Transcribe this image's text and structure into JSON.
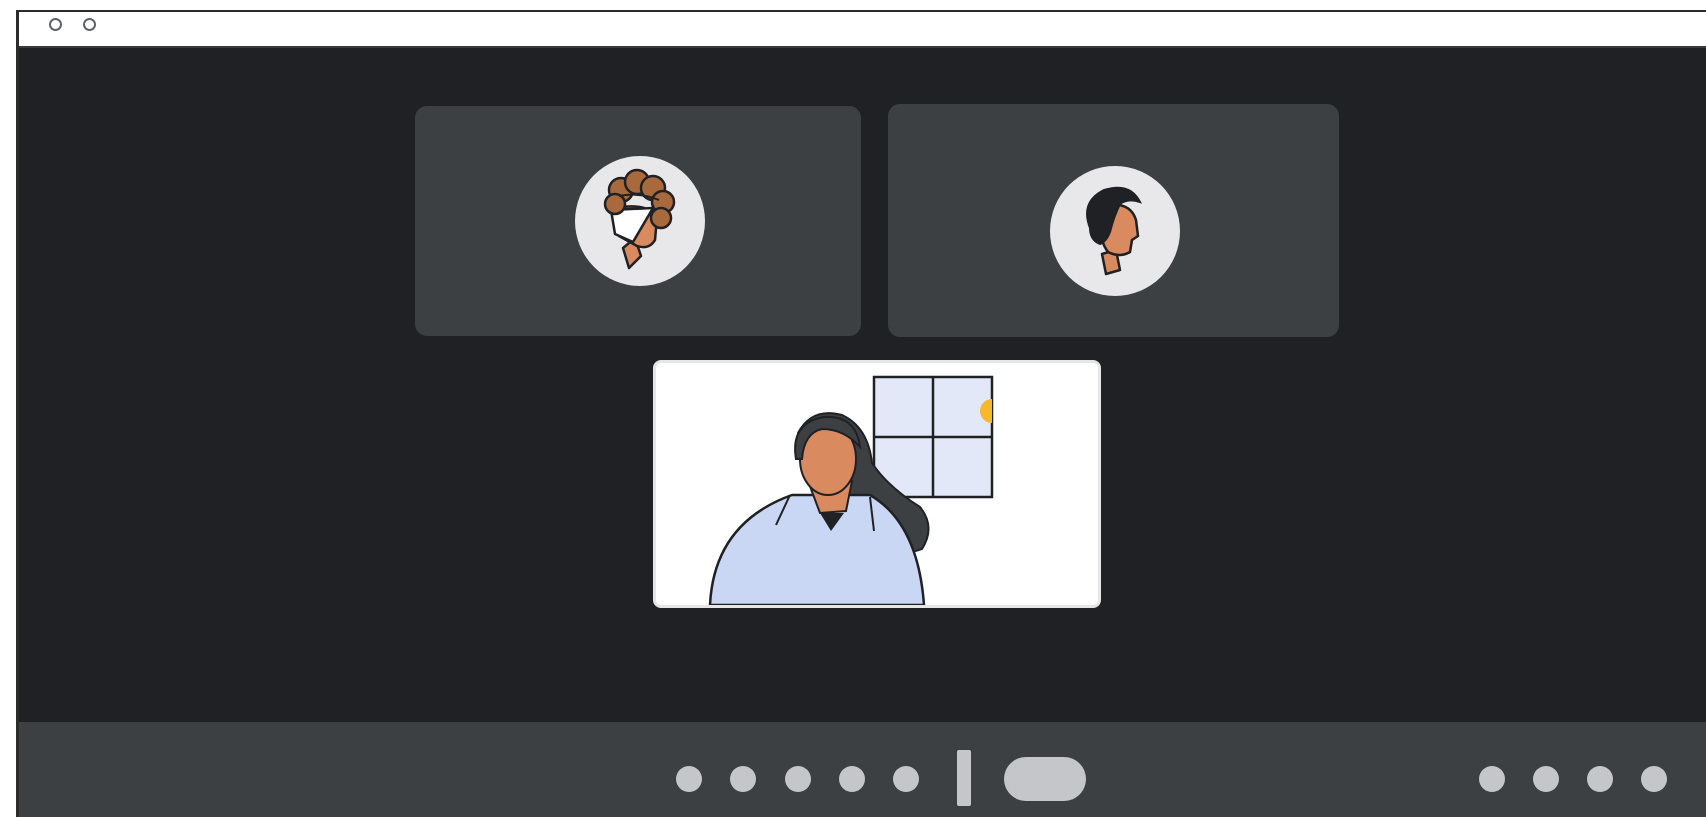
{
  "window": {
    "controls": [
      "window-control-circle",
      "window-control-circle"
    ]
  },
  "participants": [
    {
      "name_icon": "participant-avatar-icon",
      "hair_color": "#a86a3c",
      "skin_color": "#d98b5f"
    },
    {
      "name_icon": "participant-avatar-icon",
      "hair_color": "#202124",
      "skin_color": "#d98b5f"
    }
  ],
  "self_view": {
    "icon": "self-video-preview",
    "shirt_color": "#c9d7f5",
    "window_color": "#e2e8f7",
    "sun_color": "#f5b92b"
  },
  "controlbar": {
    "left_buttons": [
      "control-button-icon",
      "control-button-icon",
      "control-button-icon",
      "control-button-icon",
      "control-button-icon"
    ],
    "right_buttons": [
      "control-button-icon",
      "control-button-icon",
      "control-button-icon",
      "control-button-icon"
    ]
  },
  "colors": {
    "stage_bg": "#202124",
    "tile_bg": "#3c4043",
    "control_fg": "#c4c6c9"
  }
}
